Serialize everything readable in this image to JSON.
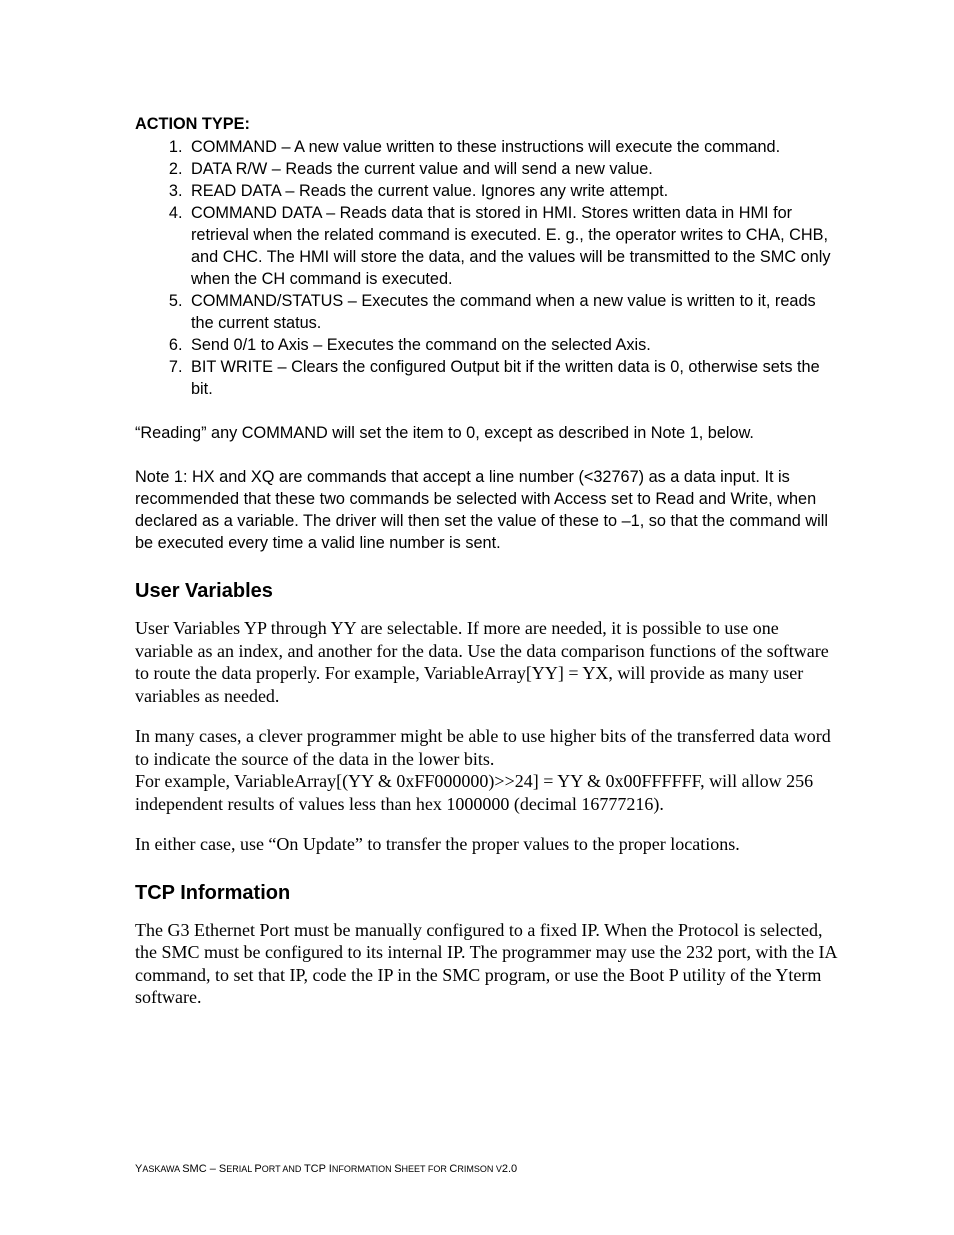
{
  "headings": {
    "action_type": "ACTION TYPE:",
    "user_variables": "User Variables",
    "tcp_information": "TCP Information"
  },
  "action_items": [
    "COMMAND – A new value written to these instructions will execute the command.",
    "DATA R/W – Reads the current value and will send a new value.",
    "READ DATA – Reads the current value. Ignores any write attempt.",
    "COMMAND DATA – Reads data that is stored in HMI. Stores written data in HMI for retrieval when the related command is executed. E. g., the operator writes to CHA, CHB, and CHC. The HMI will store the data, and the values will be transmitted to the SMC only when the CH command is executed.",
    "COMMAND/STATUS – Executes the command when a new value is written to it, reads the current status.",
    "Send 0/1 to Axis – Executes the command on the selected Axis.",
    "BIT WRITE – Clears the configured Output bit if the written data is 0, otherwise sets the bit."
  ],
  "reading_note": "“Reading” any COMMAND will set the item to 0, except as described in Note 1, below.",
  "note1": "Note 1: HX and XQ are commands that accept a line number (<32767) as a data input. It is recommended that these two commands be selected with Access set to Read and Write, when declared as a variable. The driver will then set the value of these to –1, so that the command will be executed every time a valid line number is sent.",
  "user_vars_p1": "User Variables YP through YY are selectable. If more are needed, it is possible to use one variable as an index, and another for the data. Use the data comparison functions of the software to route the data properly. For example, VariableArray[YY] = YX, will provide as many user variables as needed.",
  "user_vars_p2": "In many cases, a clever programmer might be able to use higher bits of the transferred data word to indicate the source of the data in the lower bits.\nFor example, VariableArray[(YY & 0xFF000000)>>24] = YY & 0x00FFFFFF, will allow 256 independent results of values less than hex 1000000 (decimal 16777216).",
  "user_vars_p3": "In either case, use “On Update” to transfer the proper values to the proper locations.",
  "tcp_p1": "The G3 Ethernet Port must be manually configured to a fixed IP. When the Protocol is selected, the SMC must be configured to its internal IP. The programmer may use the 232 port, with the IA command, to set that IP, code the IP in the SMC program, or use the Boot P utility of the Yterm software.",
  "footer": {
    "pre": "Y",
    "t1": "ASKAWA ",
    "t2": "SMC – S",
    "t3": "ERIAL ",
    "t4": "P",
    "t5": "ORT AND ",
    "t6": "TCP I",
    "t7": "NFORMATION ",
    "t8": "S",
    "t9": "HEET FOR ",
    "t10": "C",
    "t11": "RIMSON V",
    "t12": "2.0"
  }
}
